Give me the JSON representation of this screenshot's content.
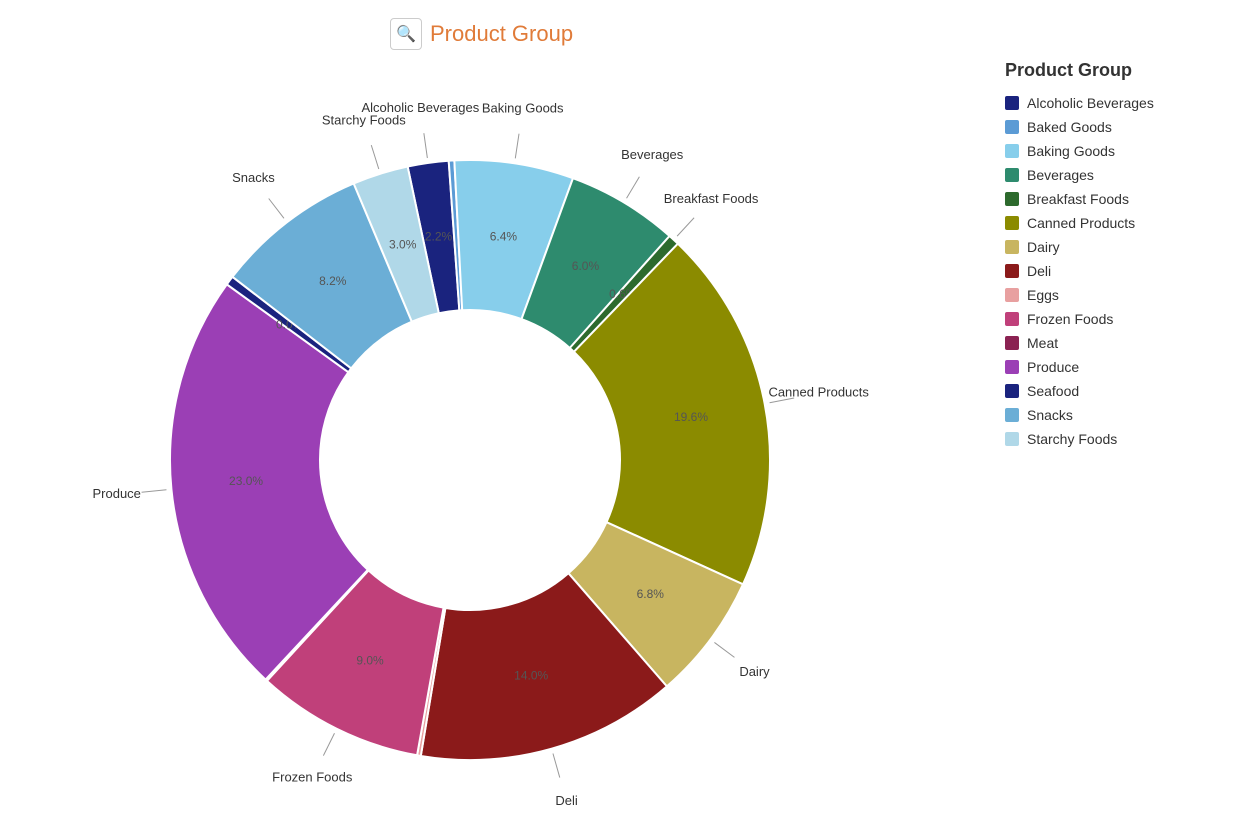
{
  "title": "Product Group",
  "icon": "🔍",
  "legend": {
    "title": "Product Group",
    "items": [
      {
        "label": "Alcoholic Beverages",
        "color": "#1a237e"
      },
      {
        "label": "Baked Goods",
        "color": "#5b9bd5"
      },
      {
        "label": "Baking Goods",
        "color": "#87ceeb"
      },
      {
        "label": "Beverages",
        "color": "#2e8b6e"
      },
      {
        "label": "Breakfast Foods",
        "color": "#2d6a2d"
      },
      {
        "label": "Canned Products",
        "color": "#8b8b00"
      },
      {
        "label": "Dairy",
        "color": "#c8b560"
      },
      {
        "label": "Deli",
        "color": "#8b1a1a"
      },
      {
        "label": "Eggs",
        "color": "#e8a0a0"
      },
      {
        "label": "Frozen Foods",
        "color": "#c0407a"
      },
      {
        "label": "Meat",
        "color": "#8b2252"
      },
      {
        "label": "Produce",
        "color": "#9b3fb5"
      },
      {
        "label": "Seafood",
        "color": "#1a237e"
      },
      {
        "label": "Snacks",
        "color": "#6baed6"
      },
      {
        "label": "Starchy Foods",
        "color": "#b0d8e8"
      }
    ]
  },
  "segments": [
    {
      "label": "Alcoholic Beverages",
      "pct": "2.2%",
      "value": 2.2,
      "color": "#1a237e",
      "labelAngle": 355
    },
    {
      "label": "Baked Goods",
      "pct": "0.0%",
      "value": 0.3,
      "color": "#5b9bd5",
      "labelAngle": 3
    },
    {
      "label": "Baking Goods",
      "pct": "6.4%",
      "value": 6.4,
      "color": "#87ceeb",
      "labelAngle": 8
    },
    {
      "label": "Beverages",
      "pct": "6.0%",
      "value": 6.0,
      "color": "#2e8b6e",
      "labelAngle": 28
    },
    {
      "label": "Breakfast Foods",
      "pct": "0.6%",
      "value": 0.6,
      "color": "#2d6a2d",
      "labelAngle": 41
    },
    {
      "label": "Canned Products",
      "pct": "19.6%",
      "value": 19.6,
      "color": "#8b8b00",
      "labelAngle": 58
    },
    {
      "label": "Dairy",
      "pct": "6.8%",
      "value": 6.8,
      "color": "#c8b560",
      "labelAngle": 115
    },
    {
      "label": "Deli",
      "pct": "14.0%",
      "value": 14.0,
      "color": "#8b1a1a",
      "labelAngle": 130
    },
    {
      "label": "Eggs",
      "pct": "0.2%",
      "value": 0.2,
      "color": "#e8a0a0",
      "labelAngle": 158
    },
    {
      "label": "Frozen Foods",
      "pct": "9.0%",
      "value": 9.0,
      "color": "#c0407a",
      "labelAngle": 163
    },
    {
      "label": "Meat",
      "pct": "0.1%",
      "value": 0.1,
      "color": "#8b2252",
      "labelAngle": 179
    },
    {
      "label": "Produce",
      "pct": "23.0%",
      "value": 23.0,
      "color": "#9b3fb5",
      "labelAngle": 195
    },
    {
      "label": "Seafood",
      "pct": "0.0%",
      "value": 0.5,
      "color": "#1a237e",
      "labelAngle": 240
    },
    {
      "label": "Snacks",
      "pct": "8.2%",
      "value": 8.2,
      "color": "#6baed6",
      "labelAngle": 255
    },
    {
      "label": "Starchy Foods",
      "pct": "3.0%",
      "value": 3.0,
      "color": "#b0d8e8",
      "labelAngle": 278
    }
  ]
}
